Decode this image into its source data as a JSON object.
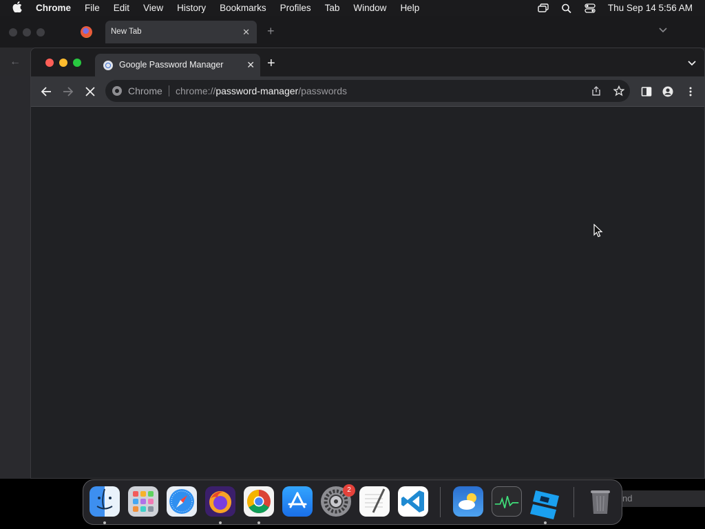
{
  "menubar": {
    "app_name": "Chrome",
    "items": [
      "File",
      "Edit",
      "View",
      "History",
      "Bookmarks",
      "Profiles",
      "Tab",
      "Window",
      "Help"
    ],
    "clock": "Thu Sep 14  5:56 AM",
    "status_icons": [
      "screen-mirroring-icon",
      "search-icon",
      "control-center-icon"
    ]
  },
  "background_window": {
    "tab_title": "New Tab",
    "tab_close": "✕",
    "new_tab": "+",
    "back": "←"
  },
  "main_window": {
    "tab_title": "Google Password Manager",
    "tab_close": "✕",
    "new_tab": "+",
    "omnibox": {
      "chip": "Chrome",
      "url_prefix": "chrome://",
      "url_host": "password-manager",
      "url_path": "/passwords"
    }
  },
  "dock": {
    "apps": [
      "Finder",
      "Launchpad",
      "Safari",
      "Firefox",
      "Google Chrome",
      "App Store",
      "System Settings",
      "TextEdit",
      "Visual Studio Code",
      "Weather",
      "Activity Monitor",
      "Roblox Studio",
      "Trash"
    ],
    "settings_badge": "2",
    "partial_text": "nd"
  },
  "colors": {
    "traffic_red": "#ff5f57",
    "traffic_yellow": "#febc2e",
    "traffic_green": "#28c840",
    "page_bg": "#202124",
    "toolbar_bg": "#35363a"
  }
}
